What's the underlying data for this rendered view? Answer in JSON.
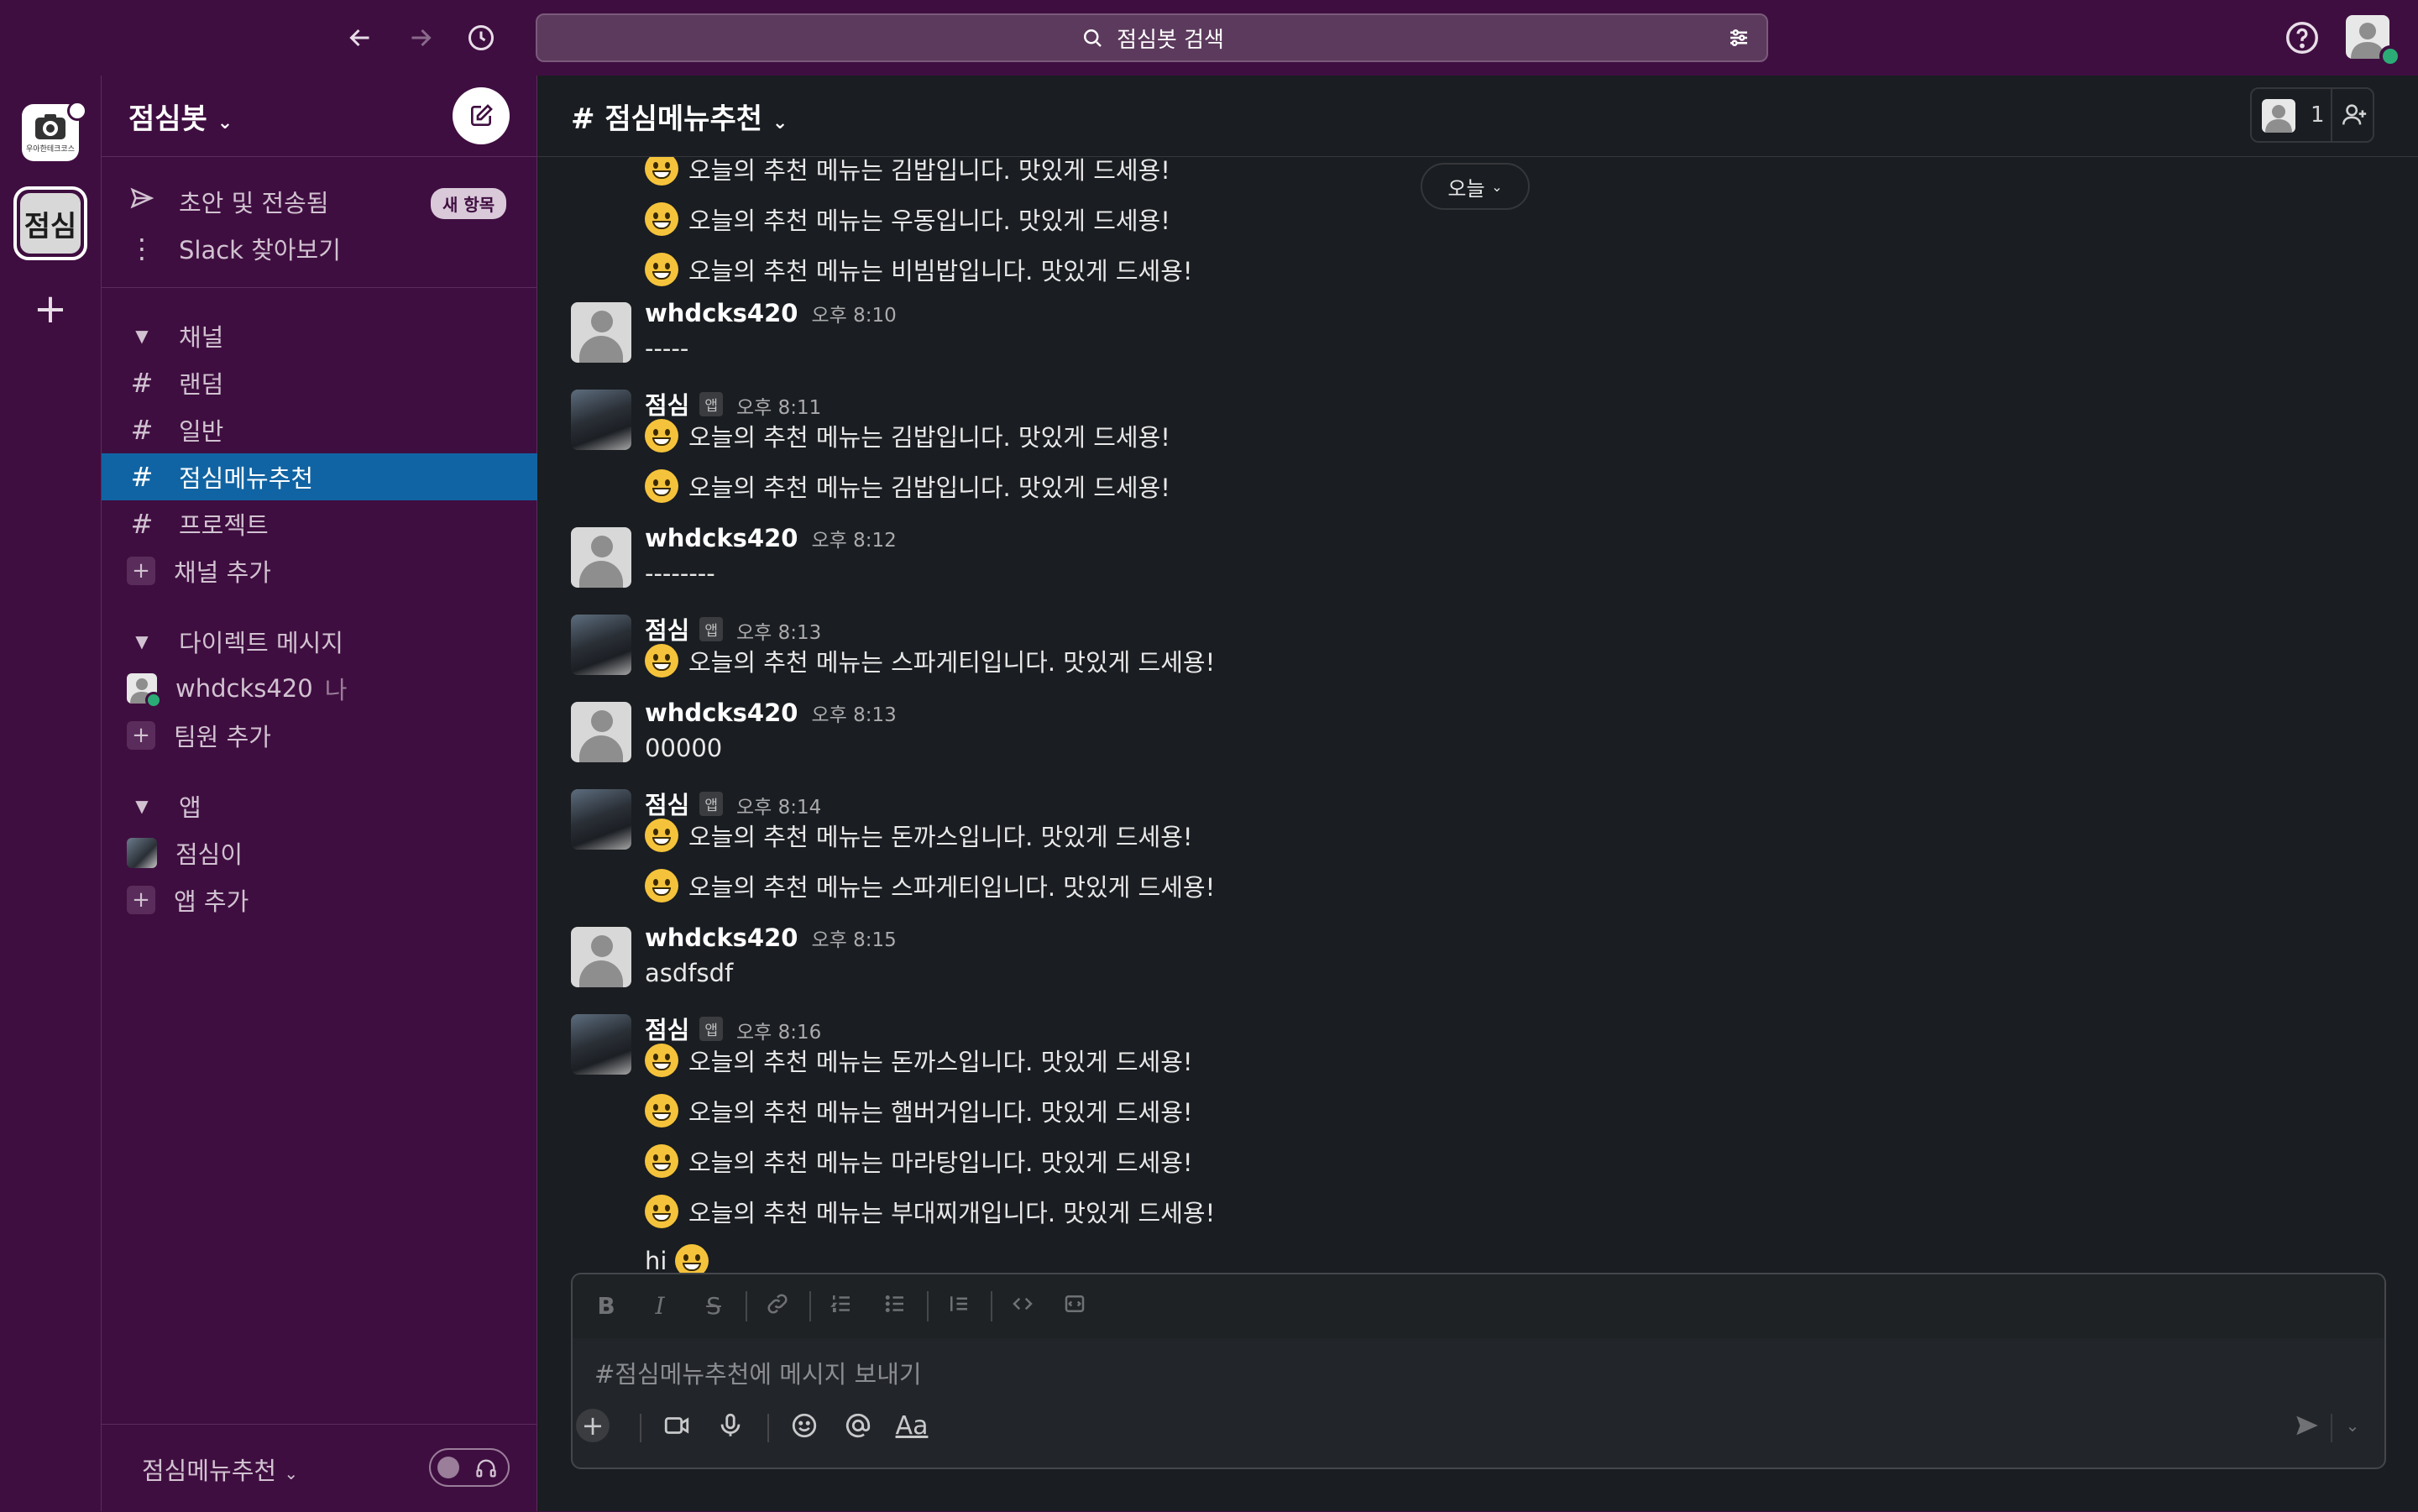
{
  "search": {
    "placeholder": "점심봇 검색"
  },
  "workspace": {
    "name": "점심봇",
    "active_icon_text": "점심",
    "logo_text": "우아한테크코스"
  },
  "sidebar": {
    "top_items": [
      {
        "label": "초안 및 전송됨",
        "badge": "새 항목",
        "icon": "send-icon"
      },
      {
        "label": "Slack 찾아보기",
        "icon": "more-vertical-icon"
      }
    ],
    "channels_section": "채널",
    "channels": [
      "랜덤",
      "일반",
      "점심메뉴추천",
      "프로젝트"
    ],
    "active_channel": "점심메뉴추천",
    "add_channel": "채널 추가",
    "dm_section": "다이렉트 메시지",
    "dm_user": "whdcks420",
    "dm_me": "나",
    "add_member": "팀원 추가",
    "apps_section": "앱",
    "app_name": "점심이",
    "add_app": "앱 추가",
    "footer_channel": "점심메뉴추천"
  },
  "channel": {
    "title": "점심메뉴추천",
    "member_count": "1"
  },
  "date_pill": "오늘",
  "messages": {
    "partial": [
      "오늘의 추천 메뉴는 김밥입니다. 맛있게 드세용!",
      "오늘의 추천 메뉴는 우동입니다. 맛있게 드세용!",
      "오늘의 추천 메뉴는 비빔밥입니다. 맛있게 드세용!"
    ],
    "groups": [
      {
        "name": "whdcks420",
        "time": "오후 8:10",
        "lines": [
          "-----"
        ]
      },
      {
        "name": "점심",
        "app": "앱",
        "time": "오후 8:11",
        "lines": [
          "오늘의 추천 메뉴는 김밥입니다. 맛있게 드세용!",
          "오늘의 추천 메뉴는 김밥입니다. 맛있게 드세용!"
        ]
      },
      {
        "name": "whdcks420",
        "time": "오후 8:12",
        "lines": [
          "--------"
        ]
      },
      {
        "name": "점심",
        "app": "앱",
        "time": "오후 8:13",
        "lines": [
          "오늘의 추천 메뉴는 스파게티입니다. 맛있게 드세용!"
        ]
      },
      {
        "name": "whdcks420",
        "time": "오후 8:13",
        "lines": [
          "00000"
        ]
      },
      {
        "name": "점심",
        "app": "앱",
        "time": "오후 8:14",
        "lines": [
          "오늘의 추천 메뉴는 돈까스입니다. 맛있게 드세용!",
          "오늘의 추천 메뉴는 스파게티입니다. 맛있게 드세용!"
        ]
      },
      {
        "name": "whdcks420",
        "time": "오후 8:15",
        "lines": [
          "asdfsdf"
        ]
      },
      {
        "name": "점심",
        "app": "앱",
        "time": "오후 8:16",
        "lines": [
          "오늘의 추천 메뉴는 돈까스입니다. 맛있게 드세용!",
          "오늘의 추천 메뉴는 햄버거입니다. 맛있게 드세용!",
          "오늘의 추천 메뉴는 마라탕입니다. 맛있게 드세용!",
          "오늘의 추천 메뉴는 부대찌개입니다. 맛있게 드세용!",
          "hi"
        ]
      }
    ]
  },
  "composer": {
    "placeholder": "#점심메뉴추천에 메시지 보내기",
    "format_tools": [
      "B",
      "I",
      "S"
    ],
    "text_style": "Aa"
  },
  "colors": {
    "aubergine": "#3f0e40",
    "active": "#1164a3",
    "main_bg": "#1a1d21",
    "presence": "#2bac76"
  }
}
